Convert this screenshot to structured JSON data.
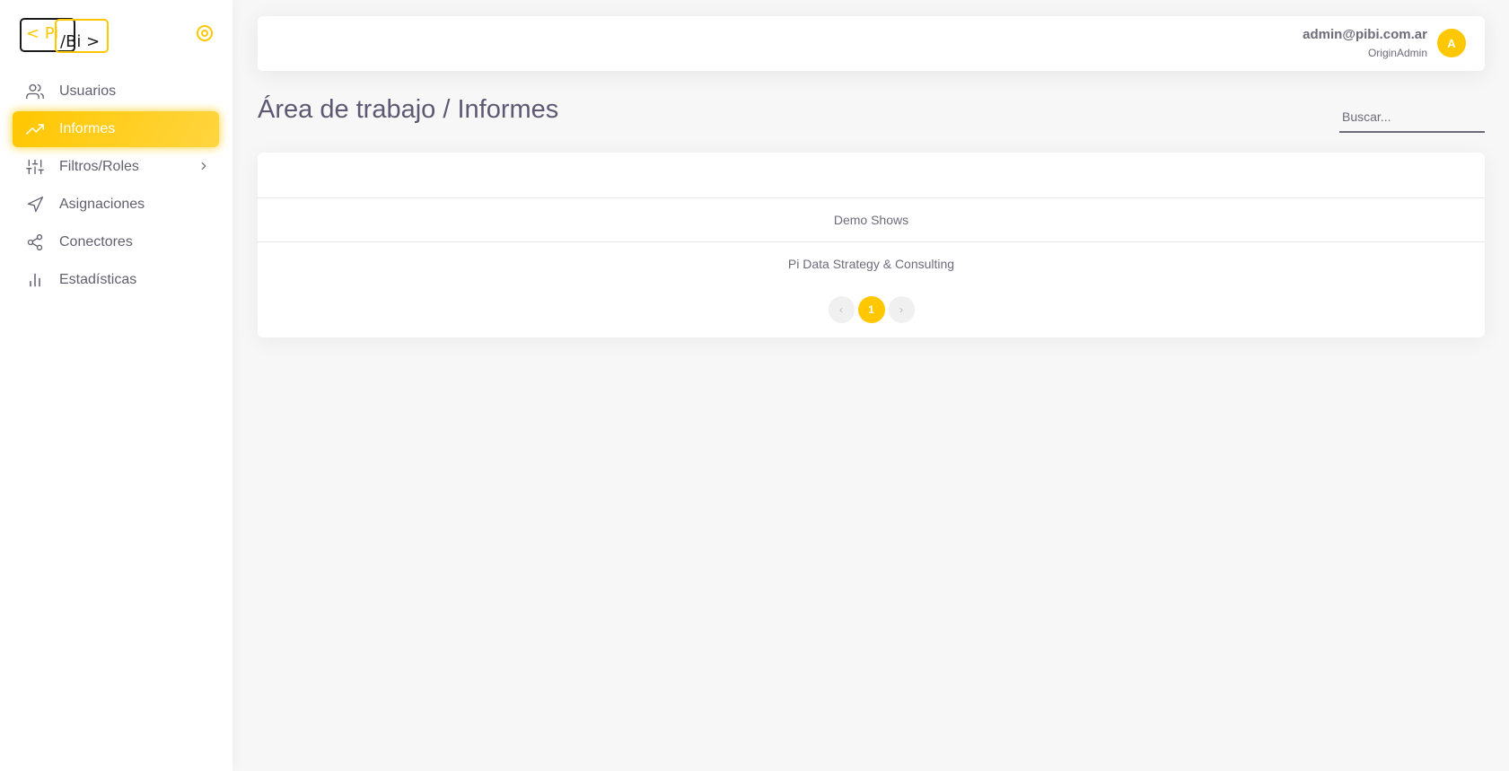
{
  "brand": {
    "logo_left": "< Pi",
    "logo_right": "/Bi >",
    "accent": "#ffc700"
  },
  "sidebar": {
    "items": [
      {
        "label": "Usuarios",
        "icon": "users-icon"
      },
      {
        "label": "Informes",
        "icon": "trending-up-icon",
        "active": true
      },
      {
        "label": "Filtros/Roles",
        "icon": "sliders-icon",
        "has_submenu": true
      },
      {
        "label": "Asignaciones",
        "icon": "navigation-icon"
      },
      {
        "label": "Conectores",
        "icon": "share-icon"
      },
      {
        "label": "Estadísticas",
        "icon": "bar-chart-icon"
      }
    ]
  },
  "navbar": {
    "user_email": "admin@pibi.com.ar",
    "user_role": "OriginAdmin",
    "avatar_initial": "A"
  },
  "page": {
    "title": "Área de trabajo / Informes",
    "search_placeholder": "Buscar..."
  },
  "reports": [
    {
      "name": "Demo Shows"
    },
    {
      "name": "Pi Data Strategy & Consulting"
    }
  ],
  "pagination": {
    "prev": "‹",
    "current": "1",
    "next": "›"
  }
}
